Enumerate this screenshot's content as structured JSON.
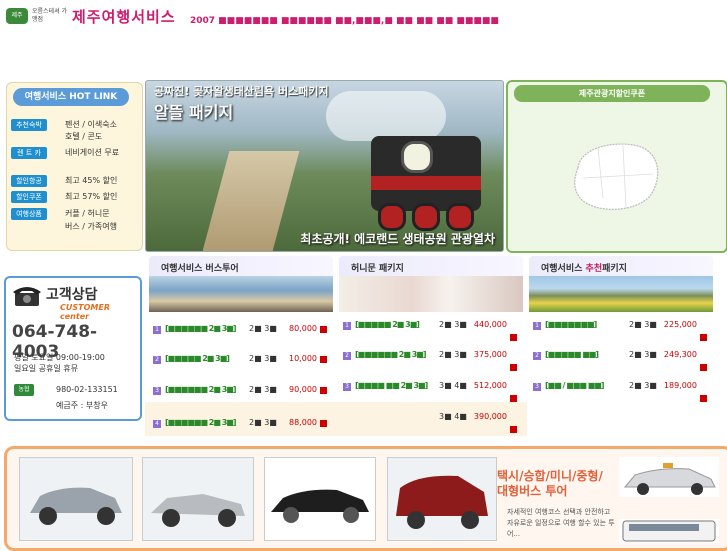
{
  "header": {
    "logo_emblem": "제주",
    "logo_small": "오름스테셔 가맹점",
    "title": "제주여행서비스",
    "ticker": "2007 ■■■■■■■ ■■■■■■ ■■,■■■,■ ■■ ■■ ■■ ■■■■■"
  },
  "hotlink": {
    "title": "여행서비스 HOT LINK",
    "items": [
      {
        "tag": "추천숙박",
        "text": "펜션 / 이색숙소"
      },
      {
        "tag": "",
        "text": "호텔 / 콘도"
      },
      {
        "tag": "렌 트 카",
        "text": "네비게이션 무료"
      },
      {
        "tag": "할인항공",
        "text": "최고 45% 할인"
      },
      {
        "tag": "할인쿠폰",
        "text": "최고 57% 할인"
      },
      {
        "tag": "여행상품",
        "text": "커플 / 허니문"
      },
      {
        "tag": "",
        "text": "버스 / 가족여행"
      }
    ]
  },
  "banner": {
    "top_text": "공짜진! 곶자왈생태산림욕 버스패키지",
    "title": "알뜰 패키지",
    "caption": "최초공개! 에코랜드 생태공원 관광열차"
  },
  "map": {
    "title": "제주관광지할인쿠폰"
  },
  "customer": {
    "title": "고객상담",
    "subtitle": "CUSTOMER center",
    "phone": "064-748-4003",
    "hours": "평일 토요일  09:00-19:00",
    "holiday": "일요일 공휴일 휴뮤",
    "bank_name": "농협",
    "bank_account": "980-02-133151",
    "bank_owner": "예금주 : 부창우"
  },
  "columns": [
    {
      "prefix": "여행서비스",
      "highlight": "",
      "title": "버스투어",
      "rows": [
        {
          "num": "1",
          "name": "[■■■■■■ 2■ 3■]",
          "sched": "2■ 3■",
          "price": "80,000"
        },
        {
          "num": "2",
          "name": "[■■■■■ 2■ 3■]",
          "sched": "2■ 3■",
          "price": "10,000"
        },
        {
          "num": "3",
          "name": "[■■■■■■ 2■ 3■]",
          "sched": "2■ 3■",
          "price": "90,000"
        },
        {
          "num": "4",
          "name": "[■■■■■■ 2■ 3■]",
          "sched": "2■ 3■",
          "price": "88,000"
        }
      ]
    },
    {
      "prefix": "허니문",
      "highlight": "",
      "title": "패키지",
      "rows": [
        {
          "num": "1",
          "name": "[■■■■■ 2■ 3■]",
          "sched": "2■ 3■",
          "price": "440,000"
        },
        {
          "num": "2",
          "name": "[■■■■■■ 2■ 3■]",
          "sched": "2■ 3■",
          "price": "375,000"
        },
        {
          "num": "3",
          "name": "[■■■■ ■■ 2■ 3■]",
          "sched": "3■ 4■",
          "price": "512,000"
        },
        {
          "num": "4",
          "name": "",
          "sched": "3■ 4■",
          "price": "390,000"
        }
      ]
    },
    {
      "prefix": "여행서비스",
      "highlight": "추천",
      "title": "패키지",
      "rows": [
        {
          "num": "1",
          "name": "[■■■■■■■]",
          "sched": "2■ 3■",
          "price": "225,000"
        },
        {
          "num": "2",
          "name": "[■■■■■ ■■]",
          "sched": "2■ 3■",
          "price": "249,300"
        },
        {
          "num": "3",
          "name": "[■■ / ■■■ ■■]",
          "sched": "2■ 3■",
          "price": "189,000"
        }
      ]
    }
  ],
  "bottom": {
    "title": "택시/승합/미니/중형/대형버스 투어",
    "desc": "자세적인 여행코스 선택과 안전하고 자유로운 일정으로 여행 할수 있는 투어..."
  }
}
